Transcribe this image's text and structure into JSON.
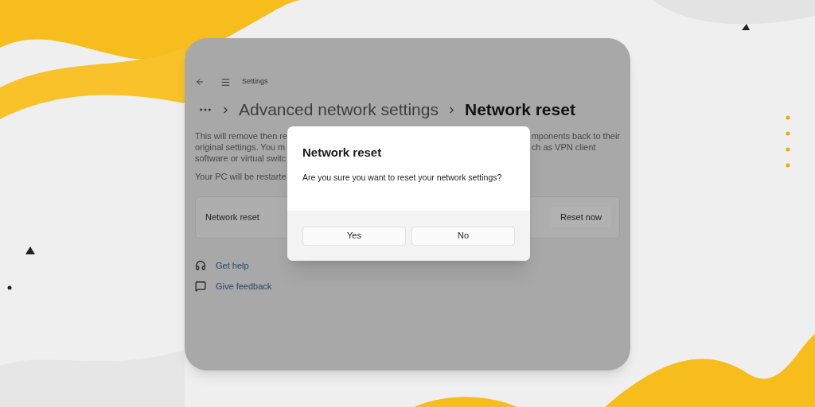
{
  "window": {
    "title": "Settings"
  },
  "breadcrumb": [
    {
      "label": "Advanced network settings",
      "current": false
    },
    {
      "label": "Network reset",
      "current": true
    }
  ],
  "description": {
    "left_lines": [
      "This will remove then re",
      "original settings. You m",
      "software or virtual switc"
    ],
    "right_lines": [
      "mponents back to their",
      "ch as VPN client"
    ]
  },
  "restart_note": "Your PC will be restarte",
  "reset_card": {
    "label": "Network reset",
    "button": "Reset now"
  },
  "links": [
    {
      "label": "Get help",
      "kind": "help"
    },
    {
      "label": "Give feedback",
      "kind": "feedback"
    }
  ],
  "dialog": {
    "title": "Network reset",
    "message": "Are you sure you want to reset your network settings?",
    "buttons": [
      "Yes",
      "No"
    ]
  }
}
